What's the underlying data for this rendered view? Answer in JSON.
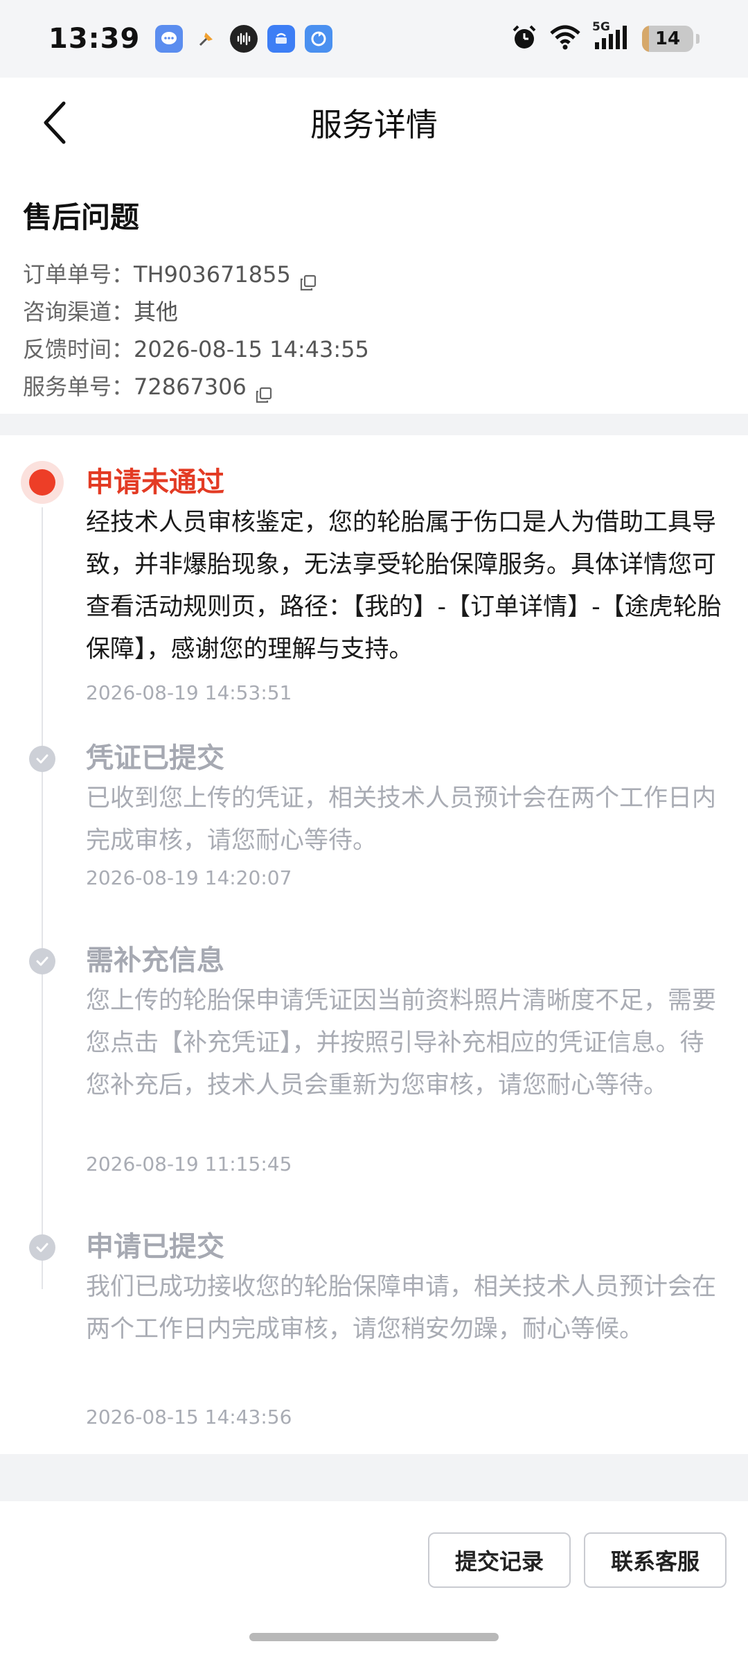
{
  "status_bar": {
    "time": "13:39",
    "battery": "14",
    "battery_level": 0.14,
    "network": "5G",
    "icons": [
      "message-icon",
      "pin-icon",
      "audio-icon",
      "appmarket-icon",
      "sync-icon",
      "alarm-icon",
      "wifi-icon",
      "signal-icon"
    ]
  },
  "header": {
    "title": "服务详情"
  },
  "info": {
    "title": "售后问题",
    "rows": [
      {
        "label": "订单单号：",
        "value": "TH903671855",
        "copy": true
      },
      {
        "label": "咨询渠道：",
        "value": "其他",
        "copy": false
      },
      {
        "label": "反馈时间：",
        "value": "2026-08-15 14:43:55",
        "copy": false
      },
      {
        "label": "服务单号：",
        "value": "72867306",
        "copy": true
      }
    ]
  },
  "timeline": {
    "items": [
      {
        "title": "申请未通过",
        "desc": "经技术人员审核鉴定，您的轮胎属于伤口是人为借助工具导致，并非爆胎现象，无法享受轮胎保障服务。具体详情您可查看活动规则页，路径：【我的】-【订单详情】-【途虎轮胎保障】，感谢您的理解与支持。",
        "time": "2026-08-19 14:53:51",
        "status": "active"
      },
      {
        "title": "凭证已提交",
        "desc": "已收到您上传的凭证，相关技术人员预计会在两个工作日内完成审核，请您耐心等待。",
        "time": "2026-08-19 14:20:07",
        "status": "done"
      },
      {
        "title": "需补充信息",
        "desc": "您上传的轮胎保申请凭证因当前资料照片清晰度不足，需要您点击【补充凭证】，并按照引导补充相应的凭证信息。待您补充后，技术人员会重新为您审核，请您耐心等待。",
        "time": "2026-08-19 11:15:45",
        "status": "done"
      },
      {
        "title": "申请已提交",
        "desc": "我们已成功接收您的轮胎保障申请，相关技术人员预计会在两个工作日内完成审核，请您稍安勿躁，耐心等候。",
        "time": "2026-08-15 14:43:56",
        "status": "done"
      }
    ]
  },
  "bottom": {
    "submit_record": "提交记录",
    "contact_service": "联系客服"
  },
  "colors": {
    "accent_red": "#e33b24",
    "muted": "#a9acb4"
  }
}
